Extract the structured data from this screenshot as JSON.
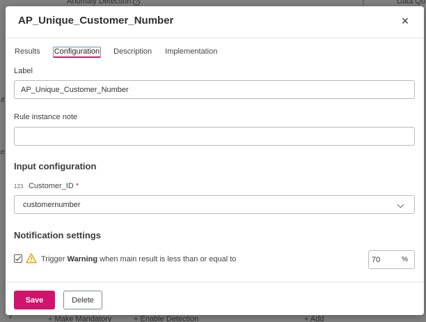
{
  "background": {
    "top_left_label": "Anomaly Detection",
    "top_left_help": "?",
    "top_menu": "⋮",
    "top_right_label": "Data Qu",
    "left_fragment_1": "ut",
    "left_fragment_2": "te",
    "bottom_chevron": "˅",
    "bottom_actions": [
      "+ Make Mandatory",
      "+ Enable Detection",
      "+ Add"
    ]
  },
  "dialog": {
    "title": "AP_Unique_Customer_Number",
    "close_glyph": "×"
  },
  "tabs": [
    {
      "label": "Results",
      "active": false
    },
    {
      "label": "Configuration",
      "active": true
    },
    {
      "label": "Description",
      "active": false
    },
    {
      "label": "Implementation",
      "active": false
    }
  ],
  "label_field": {
    "label": "Label",
    "value": "AP_Unique_Customer_Number"
  },
  "note_field": {
    "label": "Rule instance note",
    "value": ""
  },
  "input_configuration": {
    "title": "Input configuration",
    "param_type": "123",
    "param_name": "Customer_ID",
    "required_mark": "*",
    "selected_value": "customernumber"
  },
  "notification": {
    "title": "Notification settings",
    "checked": true,
    "text_prefix": "Trigger ",
    "severity": "Warning",
    "text_suffix": " when main result is less than or equal to",
    "threshold": "70",
    "unit": "%"
  },
  "actions": {
    "save_label": "Save",
    "delete_label": "Delete"
  },
  "colors": {
    "primary": "#d0136c",
    "warning": "#e5a000",
    "required": "#d0323d"
  }
}
